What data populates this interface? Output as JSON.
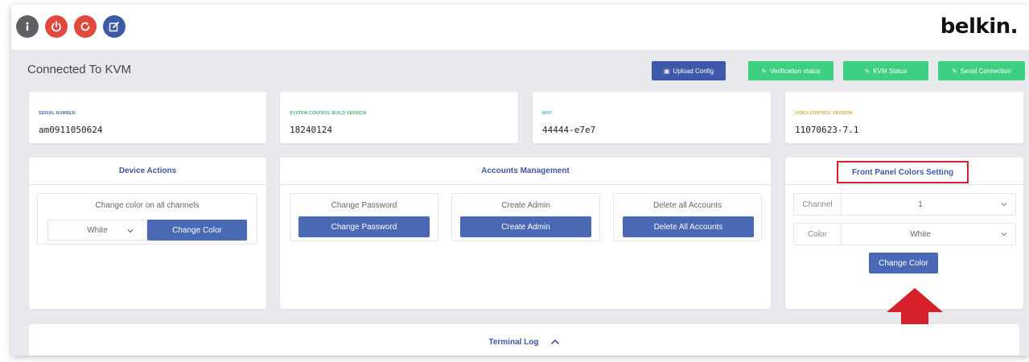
{
  "toolbar": {
    "buttons": [
      {
        "name": "info-button",
        "icon": "info-icon",
        "color": "#5f6063"
      },
      {
        "name": "power-button",
        "icon": "power-icon",
        "color": "#e2483d"
      },
      {
        "name": "restart-button",
        "icon": "restart-icon",
        "color": "#e2483d"
      },
      {
        "name": "edit-button",
        "icon": "edit-icon",
        "color": "#3d5aa8"
      }
    ],
    "logo": "belkin."
  },
  "header": {
    "title": "Connected To KVM",
    "upload_config": "Upload Config",
    "verification_status": "Verification status",
    "kvm_status": "KVM Status",
    "serial_connection": "Serial Connection"
  },
  "info_cards": [
    {
      "label": "SERIAL NUMBER",
      "value": "am0911050624",
      "label_color": "#4a69b5"
    },
    {
      "label": "SYSTEM CONTROL BUILD VERSION",
      "value": "18240124",
      "label_color": "#3fb26f"
    },
    {
      "label": "MAP",
      "value": "44444-e7e7",
      "label_color": "#4fb6c9"
    },
    {
      "label": "VIDEO CONTROL VERSION",
      "value": "11070623-7.1",
      "label_color": "#e2a43b"
    }
  ],
  "device_actions": {
    "title": "Device Actions",
    "caption": "Change color on all channels",
    "color_select": "White",
    "button": "Change Color"
  },
  "accounts": {
    "title": "Accounts Management",
    "change_password": {
      "caption": "Change Password",
      "button": "Change Password"
    },
    "create_admin": {
      "caption": "Create Admin",
      "button": "Create Admin"
    },
    "delete_accounts": {
      "caption": "Delete all Accounts",
      "button": "Delete All Accounts"
    }
  },
  "front_panel": {
    "title": "Front Panel Colors Setting",
    "channel_label": "Channel",
    "channel_value": "1",
    "color_label": "Color",
    "color_value": "White",
    "button": "Change Color"
  },
  "terminal": {
    "label": "Terminal Log"
  },
  "colors": {
    "primary": "#3d5aa8",
    "success": "#3fcf82",
    "danger": "#d6202a"
  }
}
